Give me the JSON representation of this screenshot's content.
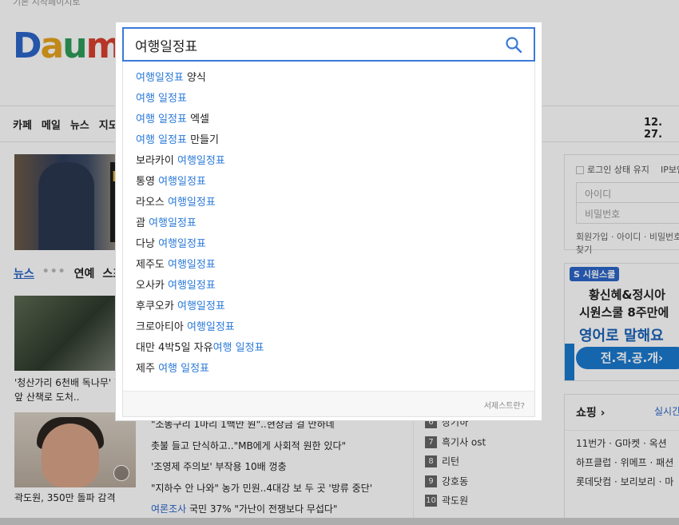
{
  "header": {
    "top_text": "기본 시작페이지로",
    "logo": {
      "chars": [
        "D",
        "a",
        "u",
        "m"
      ]
    }
  },
  "gnb": {
    "items": [
      "카페",
      "메일",
      "뉴스",
      "지도"
    ],
    "date": "12. 27."
  },
  "banner": {
    "text1": "N",
    "text2": "F"
  },
  "news": {
    "tabs": [
      "뉴스",
      "연예",
      "스포츠"
    ],
    "dots": "•••",
    "caption1": "'청산가리 6천배 독나무' 학교 앞 산책로 도처..",
    "caption2": "곽도원, 350만 돌파 감격",
    "headlines": [
      {
        "prefix": "",
        "text": "\"소똥구리 1마리 1백만 원\"..현상금 걸 만하네"
      },
      {
        "prefix": "",
        "text": "촛불 들고 단식하고..\"MB에게 사회적 원한 있다\""
      },
      {
        "prefix": "",
        "text": "'조영제 주의보' 부작용 10배 껑충"
      },
      {
        "prefix": "",
        "text": "\"지하수 안 나와\" 농가 민원..4대강 보 두 곳 '방류 중단'"
      },
      {
        "prefix": "여론조사",
        "text": " 국민 37% \"가난이 전쟁보다 무섭다\""
      }
    ]
  },
  "ranking": [
    {
      "num": "6",
      "text": "장기하"
    },
    {
      "num": "7",
      "text": "흑기사 ost"
    },
    {
      "num": "8",
      "text": "리턴"
    },
    {
      "num": "9",
      "text": "강호동"
    },
    {
      "num": "10",
      "text": "곽도원"
    }
  ],
  "login": {
    "keep": "로그인 상태 유지",
    "ip": "IP보안",
    "id_placeholder": "아이디",
    "pw_placeholder": "비밀번호",
    "links": "회원가입 · 아이디 · 비밀번호 찾기"
  },
  "ad": {
    "brand": "S 시원스쿨",
    "line1": "황신혜&정시아",
    "line2": "시원스쿨 8주만에",
    "line3": "영어로 말해요",
    "line4": "전.격.공.개›"
  },
  "shopping": {
    "title": "쇼핑 ›",
    "right": "실시간",
    "rows": [
      "11번가 · G마켓 · 옥션",
      "하프클럽 · 위메프 · 패션",
      "롯데닷컴 · 보리보리 · 마"
    ]
  },
  "search": {
    "query": "여행일정표",
    "suggestions": [
      {
        "hl": "여행일정표",
        "after": " 양식",
        "before": ""
      },
      {
        "hl": "여행 일정표",
        "after": "",
        "before": ""
      },
      {
        "hl": "여행 일정표",
        "after": " 엑셀",
        "before": ""
      },
      {
        "hl": "여행 일정표",
        "after": " 만들기",
        "before": ""
      },
      {
        "before": "보라카이 ",
        "hl": "여행일정표",
        "after": ""
      },
      {
        "before": "통영 ",
        "hl": "여행일정표",
        "after": ""
      },
      {
        "before": "라오스 ",
        "hl": "여행일정표",
        "after": ""
      },
      {
        "before": "괌 ",
        "hl": "여행일정표",
        "after": ""
      },
      {
        "before": "다낭 ",
        "hl": "여행일정표",
        "after": ""
      },
      {
        "before": "제주도 ",
        "hl": "여행일정표",
        "after": ""
      },
      {
        "before": "오사카 ",
        "hl": "여행일정표",
        "after": ""
      },
      {
        "before": "후쿠오카 ",
        "hl": "여행일정표",
        "after": ""
      },
      {
        "before": "크로아티아 ",
        "hl": "여행일정표",
        "after": ""
      },
      {
        "before": "대만 4박5일 자유",
        "hl": "여행 일정표",
        "after": ""
      },
      {
        "before": "제주 ",
        "hl": "여행 일정표",
        "after": ""
      }
    ],
    "footer_hint": "서제스트란?"
  },
  "colors": {
    "accent": "#3b7ad9",
    "highlight": "#2b7ad9"
  }
}
